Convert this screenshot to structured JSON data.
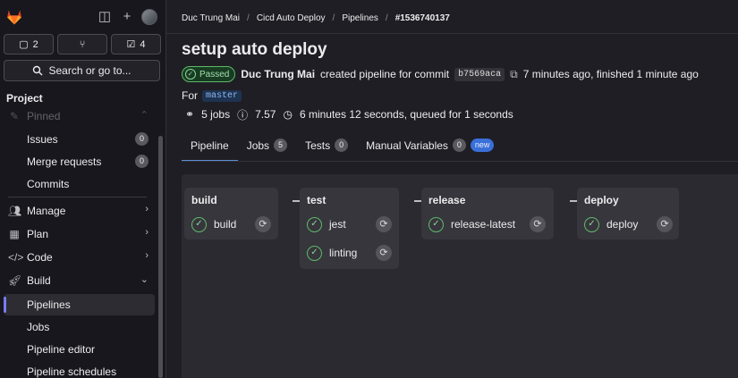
{
  "sidebar": {
    "counts": [
      {
        "icon": "issues-icon",
        "glyph": "▢",
        "value": "2"
      },
      {
        "icon": "merge-request-icon",
        "glyph": "⑂",
        "value": ""
      },
      {
        "icon": "todo-icon",
        "glyph": "☑",
        "value": "4"
      }
    ],
    "search_label": "Search or go to...",
    "project_label": "Project",
    "items": {
      "pinned": "Pinned",
      "issues": "Issues",
      "issues_count": "0",
      "merge_requests": "Merge requests",
      "merge_requests_count": "0",
      "commits": "Commits",
      "manage": "Manage",
      "plan": "Plan",
      "code": "Code",
      "build": "Build",
      "pipelines": "Pipelines",
      "jobs": "Jobs",
      "pipeline_editor": "Pipeline editor",
      "pipeline_schedules": "Pipeline schedules"
    }
  },
  "breadcrumb": {
    "user": "Duc Trung Mai",
    "project": "Cicd Auto Deploy",
    "section": "Pipelines",
    "current": "#1536740137"
  },
  "pipeline": {
    "title": "setup auto deploy",
    "status": "Passed",
    "author": "Duc Trung Mai",
    "created_text": "created pipeline for commit",
    "commit_sha": "b7569aca",
    "timing": "7 minutes ago, finished 1 minute ago",
    "for_label": "For",
    "branch": "master",
    "jobs_count": "5 jobs",
    "score": "7.57",
    "duration": "6 minutes 12 seconds, queued for 1 seconds"
  },
  "tabs": [
    {
      "label": "Pipeline",
      "count": null,
      "active": true
    },
    {
      "label": "Jobs",
      "count": "5"
    },
    {
      "label": "Tests",
      "count": "0"
    },
    {
      "label": "Manual Variables",
      "count": "0",
      "badge": "new"
    }
  ],
  "stages": [
    {
      "name": "build",
      "jobs": [
        "build"
      ]
    },
    {
      "name": "test",
      "jobs": [
        "jest",
        "linting"
      ]
    },
    {
      "name": "release",
      "jobs": [
        "release-latest"
      ]
    },
    {
      "name": "deploy",
      "jobs": [
        "deploy"
      ]
    }
  ],
  "colors": {
    "success": "#5fb96c",
    "accent": "#5b8dd9",
    "brand": "#e24329"
  }
}
